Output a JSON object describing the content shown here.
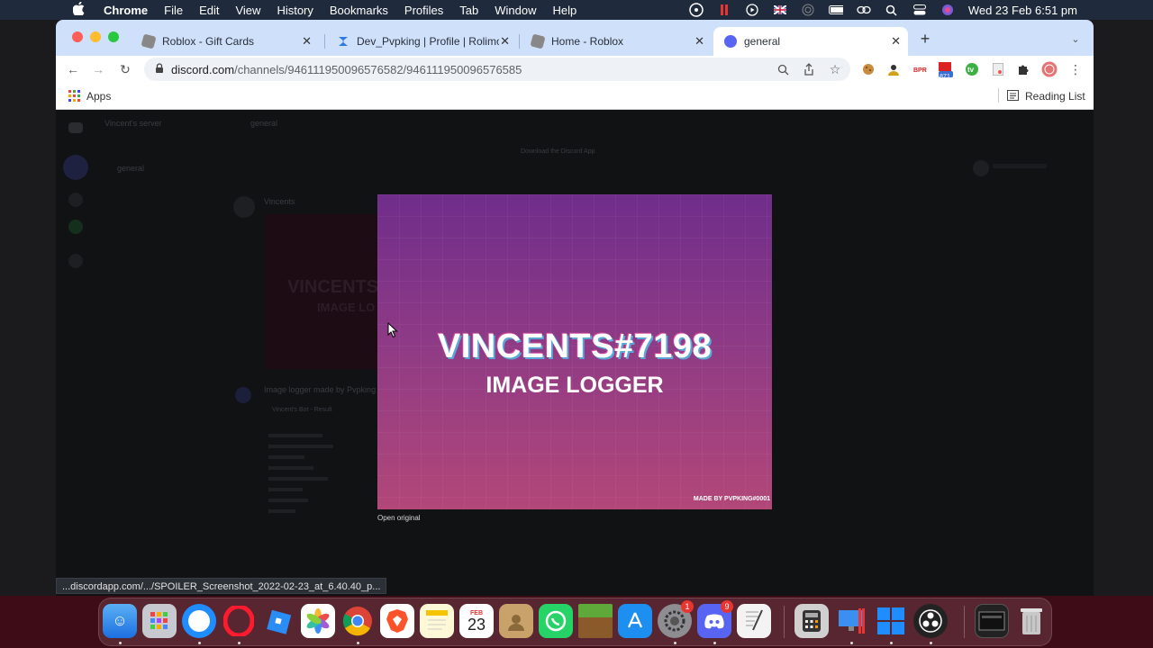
{
  "menubar": {
    "apple_icon": "apple-icon",
    "app": "Chrome",
    "items": [
      "File",
      "Edit",
      "View",
      "History",
      "Bookmarks",
      "Profiles",
      "Tab",
      "Window",
      "Help"
    ],
    "clock": "Wed 23 Feb  6:51 pm"
  },
  "tabs": [
    {
      "title": "Roblox - Gift Cards",
      "active": false
    },
    {
      "title": "Dev_Pvpking | Profile | Rolimon",
      "active": false
    },
    {
      "title": "Home - Roblox",
      "active": false
    },
    {
      "title": "general",
      "active": true
    }
  ],
  "toolbar": {
    "url_host": "discord.com",
    "url_path": "/channels/946111950096576582/946111950096576585",
    "extension_badge": "871"
  },
  "bookmarks": {
    "apps_label": "Apps",
    "reading_list_label": "Reading List"
  },
  "discord": {
    "server_name": "Vincent's server",
    "channel_header": "general",
    "channel_item": "general",
    "download_banner": "Download the Discord App",
    "message_author": "Vincents",
    "bg_title": "VINCENTS",
    "bg_subtitle": "IMAGE LO",
    "embed_author": "Image logger made by Pvpking",
    "embed_title": "Vincent's Bot - Result"
  },
  "viewer": {
    "image_title": "VINCENTS#7198",
    "image_subtitle": "IMAGE LOGGER",
    "image_credit": "MADE BY PVPKING#0001",
    "open_original": "Open original"
  },
  "status_url": "...discordapp.com/.../SPOILER_Screenshot_2022-02-23_at_6.40.40_p...",
  "dock": {
    "calendar_month": "FEB",
    "calendar_day": "23",
    "badges": {
      "system_preferences": "1",
      "discord": "9"
    }
  },
  "colors": {
    "menubar": "#1f2a3c",
    "tabbar": "#cfe0fa",
    "viewer_top": "#6f2d8a",
    "viewer_bottom": "#b24778",
    "discord_bg": "#111214"
  }
}
